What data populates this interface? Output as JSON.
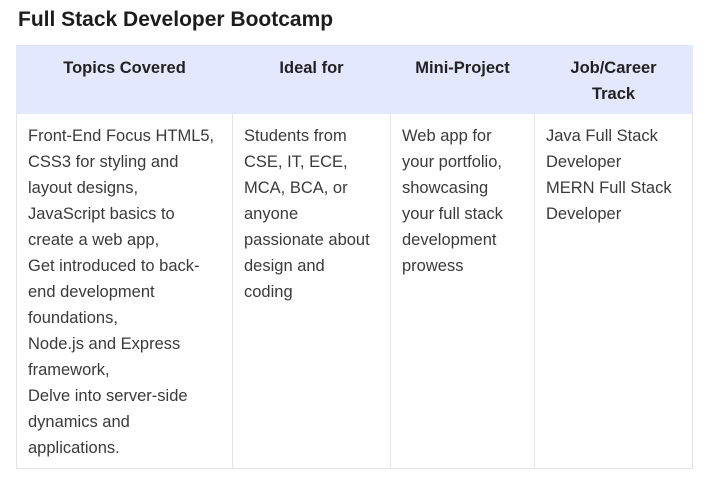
{
  "page": {
    "title": "Full Stack Developer Bootcamp"
  },
  "table": {
    "headers": {
      "topics": "Topics Covered",
      "ideal_for": "Ideal for",
      "mini_project": "Mini-Project",
      "job_track_line1": "Job/Career",
      "job_track_line2": "Track"
    },
    "topics_lines": [
      "Front-End Focus HTML5,",
      "CSS3 for styling and",
      "layout designs,",
      "JavaScript basics to",
      "create a web app,",
      "Get introduced to back-",
      "end development",
      "foundations,",
      "Node.js and Express",
      "framework,",
      "Delve into server-side",
      "dynamics and",
      "applications."
    ],
    "ideal_for_lines": [
      "Students from",
      "CSE, IT, ECE,",
      "MCA, BCA, or",
      "anyone",
      "passionate about",
      "design and",
      "coding"
    ],
    "mini_project_lines": [
      "Web app for",
      "your portfolio,",
      "showcasing",
      "your full stack",
      "development",
      "prowess"
    ],
    "job_track_lines": [
      "Java Full Stack",
      "Developer",
      "MERN Full Stack",
      "Developer"
    ]
  }
}
